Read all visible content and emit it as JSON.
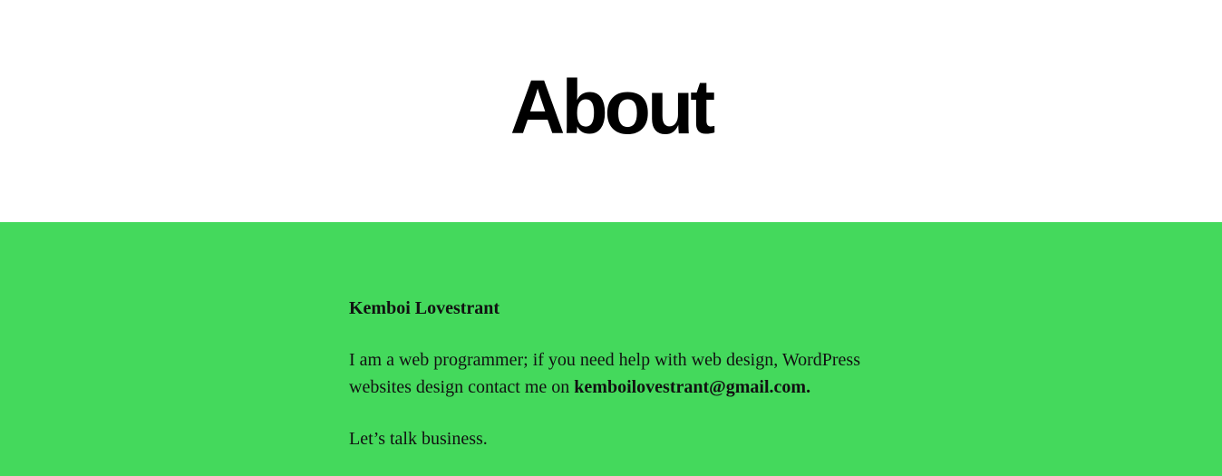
{
  "header": {
    "title": "About"
  },
  "content": {
    "author_name": "Kemboi Lovestrant",
    "intro_text": "I am a web programmer; if you need help with web design, WordPress websites design contact me on ",
    "email": "kemboilovestrant@gmail.com.",
    "closing_text": "Let’s talk business."
  },
  "colors": {
    "band_background": "#44d95c",
    "title_color": "#000000",
    "text_color": "#111111"
  }
}
